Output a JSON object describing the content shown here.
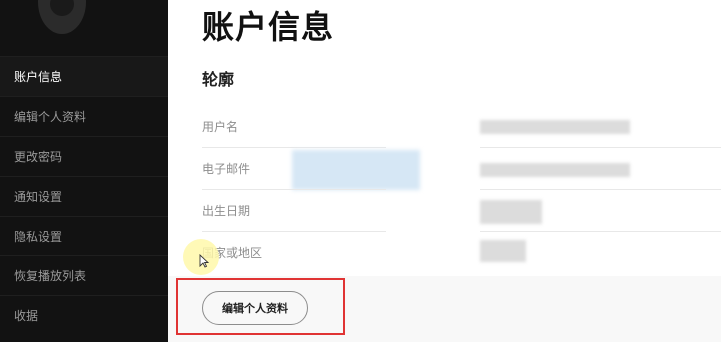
{
  "sidebar": {
    "items": [
      {
        "label": "账户信息",
        "active": true
      },
      {
        "label": "编辑个人资料",
        "active": false
      },
      {
        "label": "更改密码",
        "active": false
      },
      {
        "label": "通知设置",
        "active": false
      },
      {
        "label": "隐私设置",
        "active": false
      },
      {
        "label": "恢复播放列表",
        "active": false
      },
      {
        "label": "收据",
        "active": false
      }
    ]
  },
  "main": {
    "title": "账户信息",
    "section_title": "轮廓",
    "fields": [
      {
        "label": "用户名"
      },
      {
        "label": "电子邮件"
      },
      {
        "label": "出生日期"
      },
      {
        "label": "国家或地区"
      }
    ],
    "edit_button_label": "编辑个人资料"
  },
  "colors": {
    "sidebar_bg": "#121212",
    "highlight_box": "#e03434",
    "cursor_halo": "#fff8aa"
  }
}
